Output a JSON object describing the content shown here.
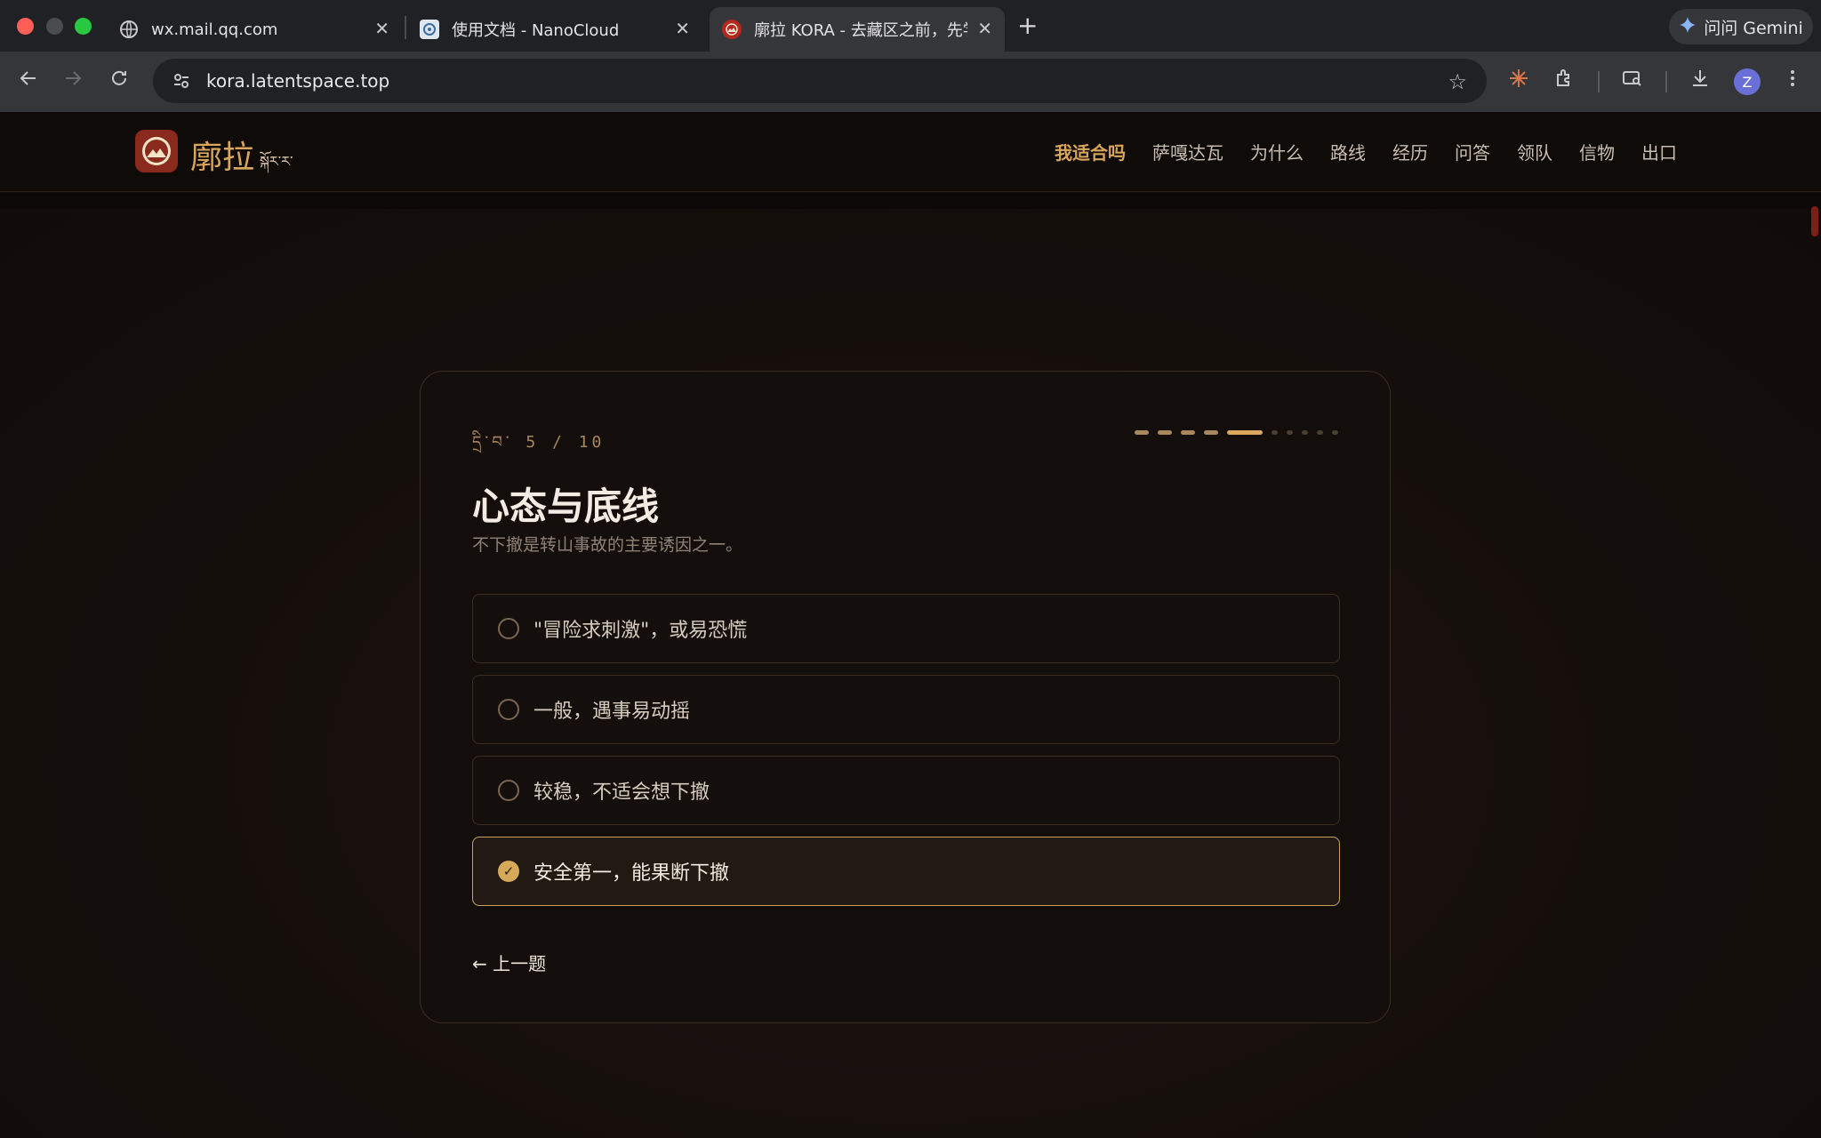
{
  "browser": {
    "tabs": [
      {
        "title": "wx.mail.qq.com",
        "icon": "globe-icon"
      },
      {
        "title": "使用文档 - NanoCloud",
        "icon": "nanocloud-icon"
      },
      {
        "title": "廓拉 KORA - 去藏区之前，先学",
        "icon": "kora-icon",
        "active": true
      }
    ],
    "new_tab": "+",
    "close_glyph": "✕",
    "gemini_label": "问问 Gemini",
    "url": "kora.latentspace.top",
    "profile_initial": "Z"
  },
  "site": {
    "logo_cn": "廓拉",
    "logo_tibetan": "སྐོར་ར་",
    "nav": [
      {
        "label": "我适合吗",
        "active": true
      },
      {
        "label": "萨嘎达瓦"
      },
      {
        "label": "为什么"
      },
      {
        "label": "路线"
      },
      {
        "label": "经历"
      },
      {
        "label": "问答"
      },
      {
        "label": "领队"
      },
      {
        "label": "信物"
      },
      {
        "label": "出口"
      }
    ]
  },
  "quiz": {
    "step_label": "དྲི་བ་ 5 / 10",
    "current": 5,
    "total": 10,
    "title": "心态与底线",
    "subtitle": "不下撤是转山事故的主要诱因之一。",
    "options": [
      {
        "label": "\"冒险求刺激\"，或易恐慌",
        "selected": false
      },
      {
        "label": "一般，遇事易动摇",
        "selected": false
      },
      {
        "label": "较稳，不适会想下撤",
        "selected": false
      },
      {
        "label": "安全第一，能果断下撤",
        "selected": true
      }
    ],
    "check_glyph": "✓",
    "prev_label": "← 上一题"
  },
  "colors": {
    "accent": "#d9a65b",
    "selected_border": "#c9a15c",
    "background": "#120d0a"
  }
}
